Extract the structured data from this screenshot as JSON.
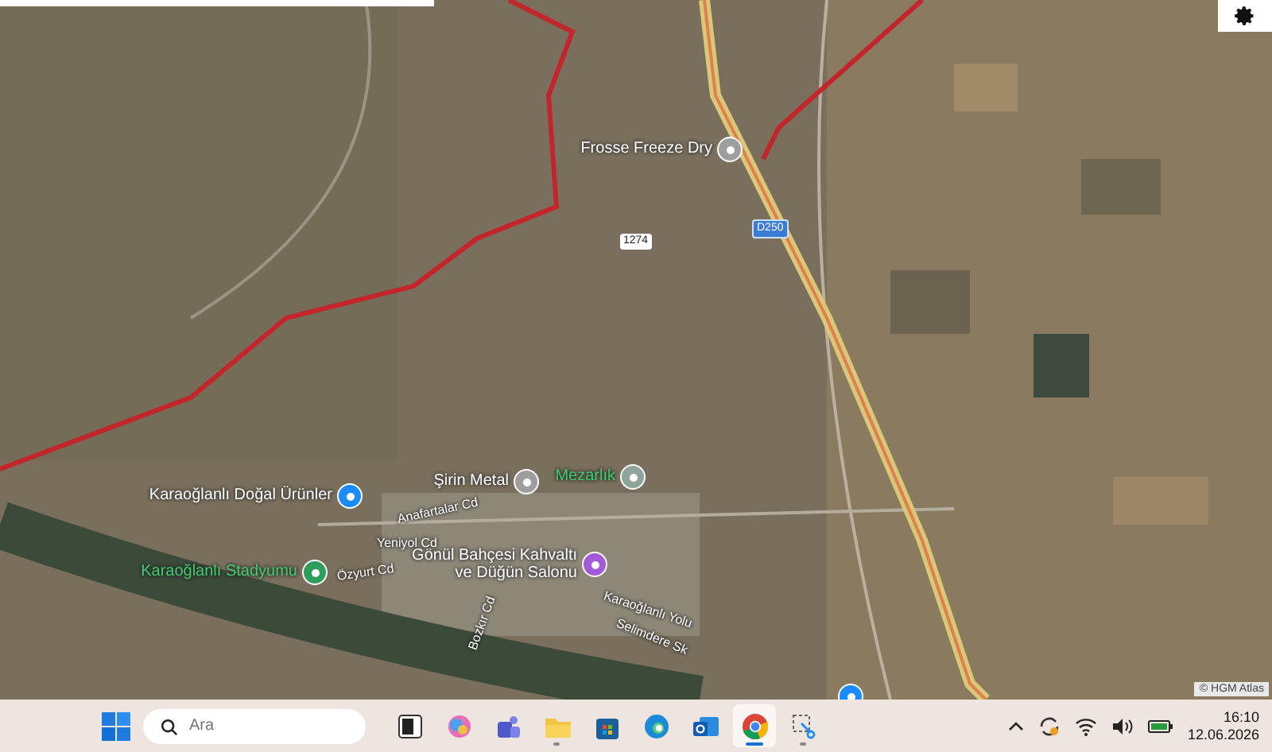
{
  "map": {
    "places": [
      {
        "name": "Frosse Freeze Dry",
        "kind": "poi",
        "color": "#9e9e9e"
      },
      {
        "name": "Şirin Metal",
        "kind": "poi",
        "color": "#9e9e9e"
      },
      {
        "name": "Mezarlık",
        "kind": "recreation",
        "color": "#8fa39a"
      },
      {
        "name": "Karaoğlanlı Doğal Ürünler",
        "kind": "poi",
        "color": "#1a8cff"
      },
      {
        "name": "Karaoğlanlı Stadyumu",
        "kind": "recreation",
        "color": "#2e9e5b"
      },
      {
        "name": "Gönül Bahçesi Kahvaltı\nve Düğün Salonu",
        "kind": "poi",
        "color": "#a35ad8"
      },
      {
        "kind": "pin",
        "color": "#1a8cff"
      }
    ],
    "streets": [
      "Anafartalar Cd",
      "Yeniyol Cd",
      "Özyurt Cd",
      "Bozkır Cd",
      "Karaoğlanlı Yolu",
      "Selimdere Sk"
    ],
    "road_numbers": [
      {
        "label": "1274",
        "kind": "local"
      },
      {
        "label": "D250",
        "kind": "highway"
      }
    ],
    "attribution": "© HGM Atlas"
  },
  "taskbar": {
    "search": {
      "placeholder": "Ara"
    },
    "apps": [
      {
        "kind": "widgets",
        "selected": false,
        "running": false
      },
      {
        "kind": "copilot",
        "selected": false,
        "running": false
      },
      {
        "kind": "teams",
        "selected": false,
        "running": false
      },
      {
        "kind": "folder",
        "selected": false,
        "running": true
      },
      {
        "kind": "store",
        "selected": false,
        "running": false
      },
      {
        "kind": "edge",
        "selected": false,
        "running": false
      },
      {
        "kind": "outlook",
        "selected": false,
        "running": false
      },
      {
        "kind": "chrome",
        "selected": true,
        "running": true
      },
      {
        "kind": "snip",
        "selected": false,
        "running": true
      }
    ],
    "time": "16:10",
    "date": "12.06.2026"
  }
}
